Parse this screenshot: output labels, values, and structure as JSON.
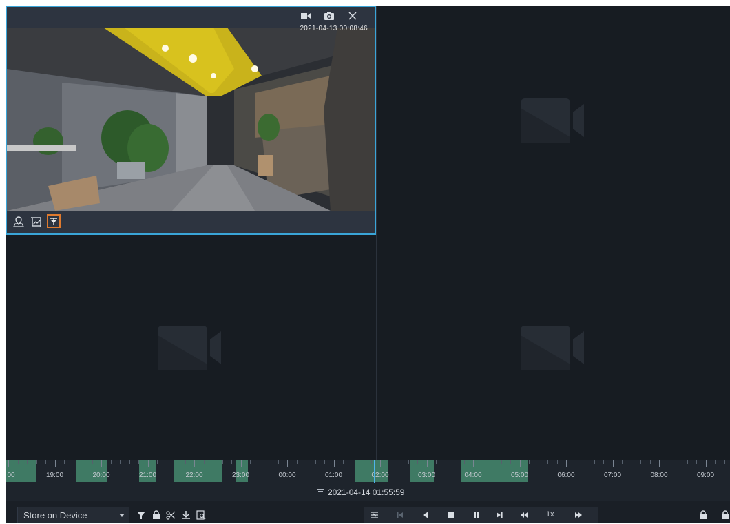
{
  "camera": {
    "timestamp": "2021-04-13 00:08:46",
    "top_icons": [
      "record-icon",
      "snapshot-icon",
      "close-icon"
    ],
    "bottom_tools": [
      "map-pin-icon",
      "image-crop-icon",
      "pin-icon"
    ]
  },
  "timeline": {
    "tick_labels": [
      "00",
      "19:00",
      "20:00",
      "21:00",
      "22:00",
      "23:00",
      "00:00",
      "01:00",
      "02:00",
      "03:00",
      "04:00",
      "05:00",
      "06:00",
      "07:00",
      "08:00",
      "09:00"
    ],
    "current_datetime": "2021-04-14 01:55:59"
  },
  "toolbar": {
    "storage_select": "Store on Device",
    "left_icons": [
      "filter-icon",
      "lock-icon",
      "scissors-icon",
      "download-icon",
      "search-record-icon"
    ],
    "playback_icons": [
      "sync-icon",
      "skip-start-icon",
      "play-back-icon",
      "stop-icon",
      "pause-icon",
      "next-frame-icon",
      "slow-icon",
      "fast-icon"
    ],
    "speed": "1x",
    "right_icons": [
      "lock-icon",
      "lock-icon"
    ]
  },
  "colors": {
    "accent_selected": "#3aa5d8",
    "active_tool": "#e07a2e",
    "record_segment": "#3f7a64",
    "cursor": "#4fb4ea"
  }
}
